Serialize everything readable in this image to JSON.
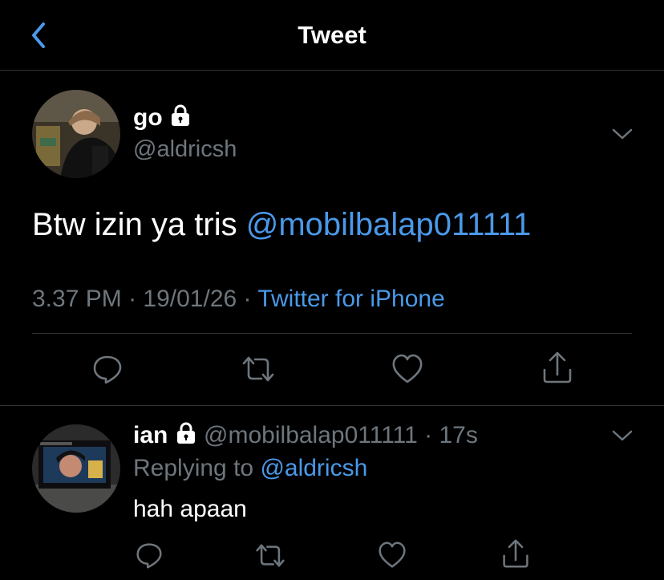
{
  "header": {
    "title": "Tweet"
  },
  "tweet": {
    "author_name": "go",
    "author_handle": "@aldricsh",
    "text_plain": "Btw izin ya tris ",
    "text_mention": "@mobilbalap011111",
    "time": "3.37 PM",
    "sep1": " · ",
    "date": "19/01/26",
    "sep2": " · ",
    "source": "Twitter for iPhone"
  },
  "reply": {
    "author_name": "ian",
    "author_handle": "@mobilbalap011111",
    "sep": " · ",
    "age": "17s",
    "replying_prefix": "Replying to ",
    "replying_to": "@aldricsh",
    "text": "hah apaan"
  },
  "icons": {
    "back": "chevron-left-icon",
    "reply": "comment-icon",
    "retweet": "retweet-icon",
    "like": "heart-icon",
    "share": "share-icon",
    "lock": "lock-icon",
    "more": "chevron-down-icon"
  },
  "colors": {
    "background": "#000000",
    "accent": "#4a99e9",
    "muted": "#6e767d",
    "divider": "#2f3336",
    "text": "#ffffff"
  }
}
